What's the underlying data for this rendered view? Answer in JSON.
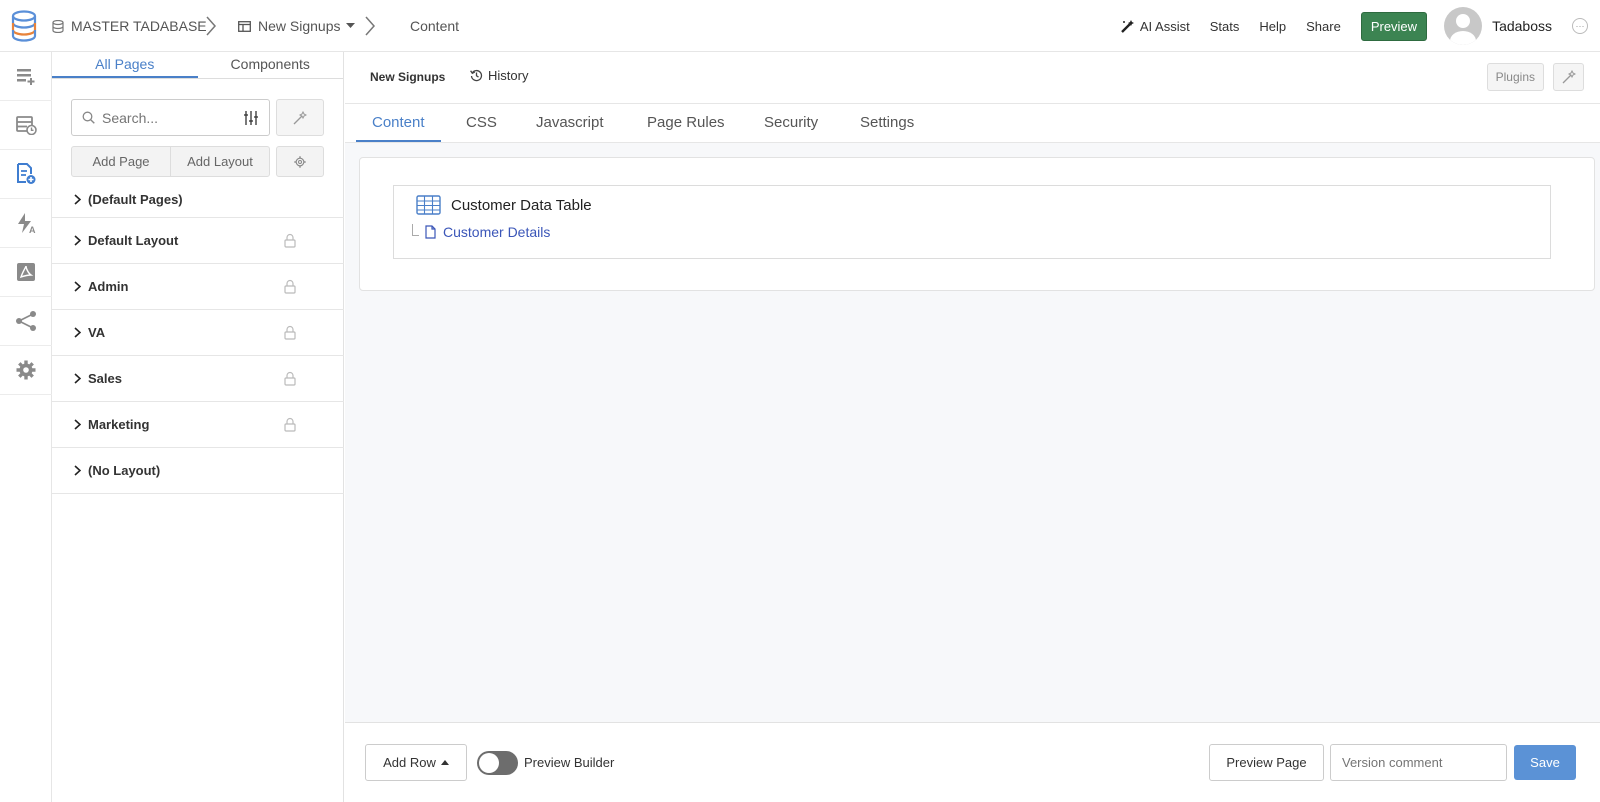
{
  "breadcrumb": {
    "root": "MASTER TADABASE",
    "section": "New Signups",
    "current": "Content"
  },
  "topbar": {
    "ai_assist": "AI Assist",
    "stats": "Stats",
    "help": "Help",
    "share": "Share",
    "preview": "Preview",
    "username": "Tadaboss",
    "more": "···"
  },
  "rail": {
    "items": [
      "data-builder-icon",
      "table-builder-icon",
      "page-builder-icon",
      "automation-icon",
      "pdf-icon",
      "share-icon",
      "settings-icon"
    ]
  },
  "panel": {
    "tabs": [
      "All Pages",
      "Components"
    ],
    "search_placeholder": "Search...",
    "add_page": "Add Page",
    "add_layout": "Add Layout",
    "pages": [
      {
        "label": "(Default Pages)",
        "locked": false
      },
      {
        "label": "Default Layout",
        "locked": true
      },
      {
        "label": "Admin",
        "locked": true
      },
      {
        "label": "VA",
        "locked": true
      },
      {
        "label": "Sales",
        "locked": true
      },
      {
        "label": "Marketing",
        "locked": true
      },
      {
        "label": "(No Layout)",
        "locked": false
      }
    ]
  },
  "main": {
    "page_name": "New Signups",
    "history": "History",
    "plugins": "Plugins",
    "tabs": [
      "Content",
      "CSS",
      "Javascript",
      "Page Rules",
      "Security",
      "Settings"
    ],
    "component": {
      "title": "Customer Data Table",
      "child": "Customer Details"
    }
  },
  "footer": {
    "add_row": "Add Row",
    "preview_builder": "Preview Builder",
    "preview_page": "Preview Page",
    "version_placeholder": "Version comment",
    "save": "Save"
  },
  "colors": {
    "accent": "#4a80c8",
    "preview_green": "#3c8452",
    "save_blue": "#5b92d6",
    "link": "#3b56b8"
  }
}
